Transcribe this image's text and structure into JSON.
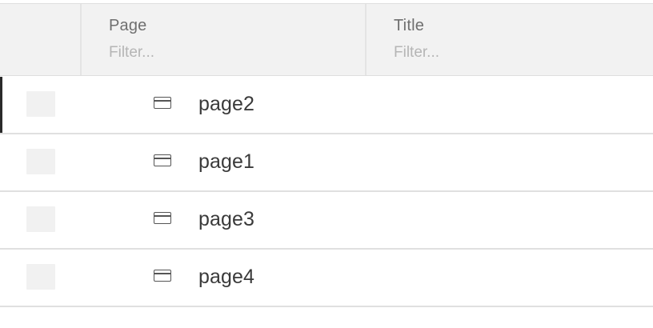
{
  "columns": {
    "page": {
      "label": "Page",
      "filter_placeholder": "Filter..."
    },
    "title": {
      "label": "Title",
      "filter_placeholder": "Filter..."
    }
  },
  "rows": [
    {
      "name": "page2",
      "title": "",
      "active": true
    },
    {
      "name": "page1",
      "title": "",
      "active": false
    },
    {
      "name": "page3",
      "title": "",
      "active": false
    },
    {
      "name": "page4",
      "title": "",
      "active": false
    }
  ]
}
